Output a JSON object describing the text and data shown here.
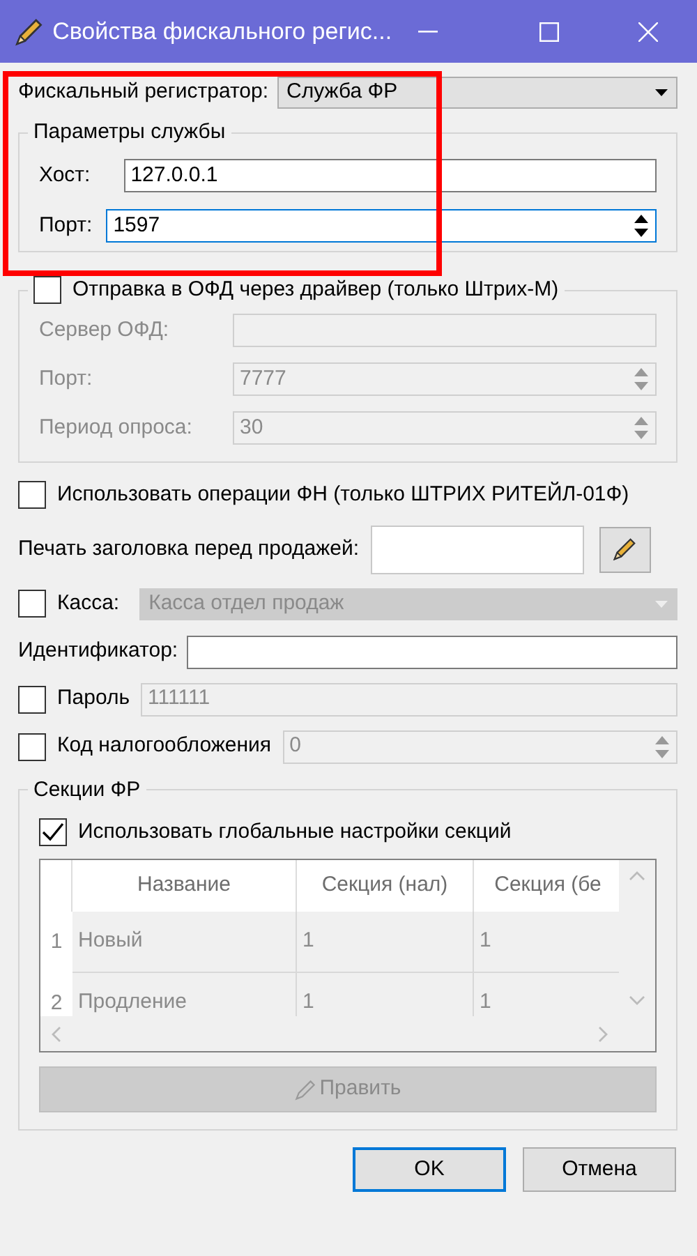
{
  "window": {
    "title": "Свойства фискального регис..."
  },
  "fiscal_registrar": {
    "label": "Фискальный регистратор:",
    "value": "Служба ФР",
    "highlighted": true
  },
  "service_params": {
    "title": "Параметры службы",
    "host_label": "Хост:",
    "host": "127.0.0.1",
    "port_label": "Порт:",
    "port": "1597"
  },
  "ofd": {
    "label": "Отправка в ОФД через драйвер (только Штрих-М)",
    "checked": false,
    "fields": [
      {
        "label": "Сервер ОФД:",
        "kind": "text"
      },
      {
        "label": "Порт:",
        "value": "7777",
        "kind": "spin"
      },
      {
        "label": "Период опроса:",
        "value": "30",
        "kind": "spin"
      }
    ]
  },
  "fn_ops": {
    "label": "Использовать операции ФН (только ШТРИХ РИТЕЙЛ-01Ф)",
    "checked": false
  },
  "header_print": {
    "label": "Печать заголовка перед продажей:"
  },
  "kassa": {
    "label": "Касса:",
    "checked": false,
    "value": "Касса отдел продаж"
  },
  "identifier": {
    "label": "Идентификатор:"
  },
  "password": {
    "label": "Пароль",
    "checked": false,
    "value": "111111"
  },
  "tax_code": {
    "label": "Код налогообложения",
    "checked": false,
    "value": "0"
  },
  "sections": {
    "title": "Секции ФР",
    "use_global": {
      "label": "Использовать глобальные настройки секций",
      "checked": true
    },
    "table": {
      "columns": [
        "Название",
        "Секция (нал)",
        "Секция (бе"
      ],
      "rows": [
        {
          "number": "1",
          "cells": [
            "Новый",
            "1",
            "1"
          ]
        },
        {
          "number": "2",
          "cells": [
            "Продление",
            "1",
            "1"
          ]
        }
      ]
    },
    "edit_button": {
      "label": "Править"
    }
  },
  "buttons": [
    {
      "label": "OK",
      "default": true
    },
    {
      "label": "Отмена",
      "default": false
    }
  ]
}
